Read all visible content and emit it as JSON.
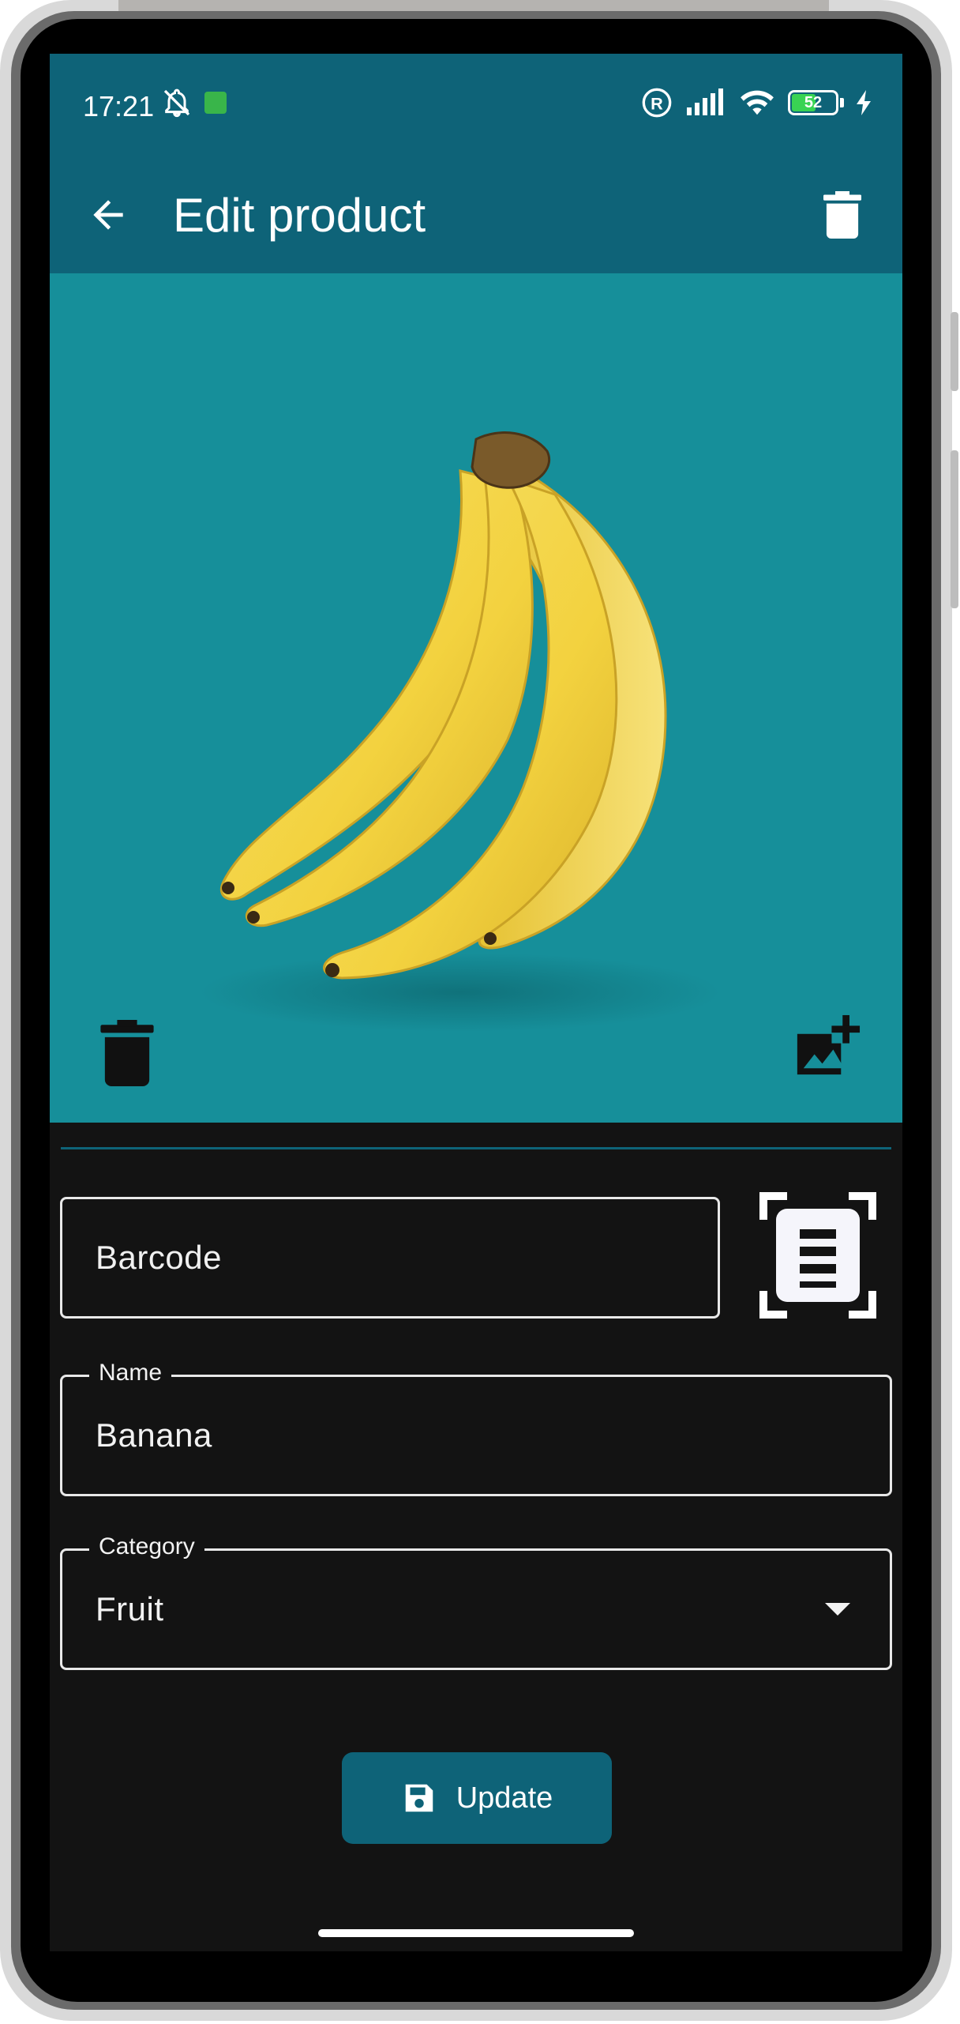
{
  "status_bar": {
    "time": "17:21",
    "battery_level": "52",
    "icons": [
      "notifications-off-icon",
      "app-notification-icon",
      "registered-icon",
      "signal-icon",
      "wifi-icon",
      "battery-icon",
      "charging-icon"
    ]
  },
  "app_bar": {
    "title": "Edit product",
    "back_icon": "arrow-back-icon",
    "delete_icon": "trash-icon"
  },
  "image_section": {
    "image_subject": "banana bunch",
    "remove_image_icon": "trash-icon",
    "add_image_icon": "add-photo-icon"
  },
  "form": {
    "barcode": {
      "placeholder": "Barcode",
      "value": ""
    },
    "scan_icon": "barcode-scanner-icon",
    "name": {
      "label": "Name",
      "value": "Banana"
    },
    "category": {
      "label": "Category",
      "value": "Fruit"
    },
    "update_button": {
      "label": "Update",
      "icon": "save-icon"
    }
  },
  "colors": {
    "primary": "#0e6378",
    "image_background": "#168f9a",
    "surface": "#131313",
    "text": "#f2f2f2"
  }
}
